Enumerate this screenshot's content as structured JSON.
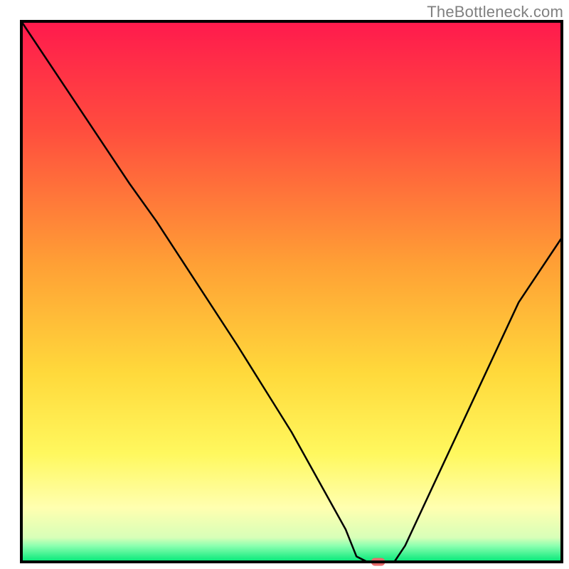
{
  "watermark": "TheBottleneck.com",
  "chart_data": {
    "type": "line",
    "title": "",
    "xlabel": "",
    "ylabel": "",
    "xlim": [
      0,
      100
    ],
    "ylim": [
      0,
      100
    ],
    "background_gradient": {
      "stops": [
        {
          "offset": 0.0,
          "color": "#ff1a4d"
        },
        {
          "offset": 0.2,
          "color": "#ff4d3e"
        },
        {
          "offset": 0.45,
          "color": "#ffa035"
        },
        {
          "offset": 0.65,
          "color": "#ffd93b"
        },
        {
          "offset": 0.8,
          "color": "#fff85e"
        },
        {
          "offset": 0.9,
          "color": "#ffffb0"
        },
        {
          "offset": 0.955,
          "color": "#d8ffb8"
        },
        {
          "offset": 0.97,
          "color": "#8dffb0"
        },
        {
          "offset": 1.0,
          "color": "#00e878"
        }
      ]
    },
    "curve_points": [
      {
        "x": 0,
        "y": 100
      },
      {
        "x": 20,
        "y": 70
      },
      {
        "x": 25,
        "y": 63
      },
      {
        "x": 40,
        "y": 40
      },
      {
        "x": 50,
        "y": 24
      },
      {
        "x": 55,
        "y": 15
      },
      {
        "x": 60,
        "y": 6
      },
      {
        "x": 62,
        "y": 1
      },
      {
        "x": 64,
        "y": 0
      },
      {
        "x": 67,
        "y": 0
      },
      {
        "x": 69,
        "y": 0
      },
      {
        "x": 71,
        "y": 3
      },
      {
        "x": 78,
        "y": 18
      },
      {
        "x": 85,
        "y": 33
      },
      {
        "x": 92,
        "y": 48
      },
      {
        "x": 100,
        "y": 60
      }
    ],
    "marker": {
      "x": 66,
      "y": 0,
      "color": "#e66a6a",
      "rx": 9,
      "ry": 5
    },
    "frame_stroke": "#000000",
    "curve_stroke": "#000000"
  }
}
